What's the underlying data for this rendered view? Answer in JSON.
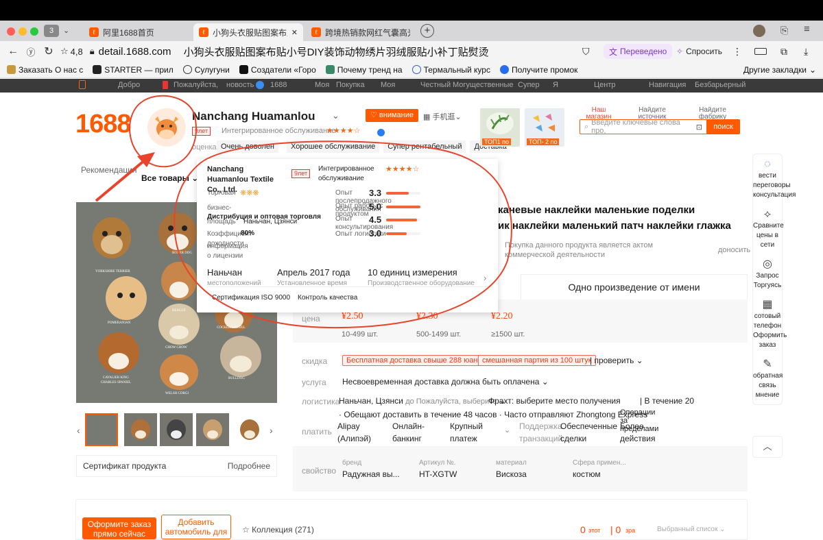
{
  "browser": {
    "tabs": [
      {
        "label": "阿里1688首页"
      },
      {
        "label": "小狗头衣服贴图案布贴小"
      },
      {
        "label": "跨境热销款网红气囊高光唇"
      }
    ],
    "tab_count": "3",
    "rating": "4,8",
    "url": "detail.1688.com",
    "page_title": "小狗头衣服贴图案布贴小号DIY装饰动物绣片羽绒服贴小补丁贴熨烫",
    "translated_label": "Переведено",
    "ask_label": "Спросить",
    "bookmarks": [
      "Заказать О нас с",
      "STARTER — прил",
      "Сулугуни",
      "Создатели «Горо",
      "Почему тренд на",
      "Термальный курс",
      "Получите промок"
    ],
    "other_bookmarks": "Другие закладки"
  },
  "site_nav": [
    "Добро",
    "Пожалуйста,",
    "новость",
    "1688",
    "Моя",
    "Покупка",
    "Моя",
    "Честный",
    "Могущественные",
    "Супер",
    "Я",
    "Центр",
    "Навигация",
    "Безбарьерный"
  ],
  "shop": {
    "logo": "1688",
    "name": "Nanchang Huamanlou",
    "follow": "внимание",
    "mobile": "手机逛",
    "years_badge": "9лет",
    "integrated": "Интегрированное обслуживание",
    "rating_label": "оценка",
    "criteria": [
      "Очень доволен",
      "Хорошее обслуживание",
      "Супер рентабельный",
      "Доставка"
    ],
    "top_badges": [
      "ТОП1 по",
      "ТОП- 2 по"
    ],
    "search_links": [
      "Наш магазин",
      "Найдите источник",
      "Найдите фабрику"
    ],
    "search_placeholder": "Введите ключевые слова про,",
    "search_button": "поиск"
  },
  "menu": {
    "recommend": "Рекомендация",
    "all_goods": "Все товары"
  },
  "popup": {
    "company": "Nanchang Huamanlou Textile Co., Ltd.",
    "years_badge": "9лет",
    "integrated": "Интегрированное обслуживание",
    "trade_medal_label": "Торговая медаль",
    "business_label": "бизнес-",
    "business_value": "Дистрибуция и оптовая торговля",
    "area_label": "площадь",
    "area_value": "Наньчан, Цзянси",
    "coeff_label": "Коэффициент доходности",
    "coeff_value": "80%",
    "license_label": "информация о лицензии",
    "stats": [
      {
        "label": "Опыт послепродажного обслуживания",
        "value": "3.3",
        "fill": 0.66
      },
      {
        "label": "Опыт работы с продуктом",
        "value": "5.0",
        "fill": 1.0
      },
      {
        "label": "Опыт консультирования",
        "value": "4.5",
        "fill": 0.9
      },
      {
        "label": "Опыт логистики",
        "value": "3.0",
        "fill": 0.6
      }
    ],
    "location_value": "Наньчан",
    "location_label": "местоположений",
    "established_value": "Апрель 2017 года",
    "established_label": "Установленное время",
    "units_value": "10 единиц измерения",
    "units_label": "Производственное оборудование",
    "certs": [
      "Сертификация ISO 9000",
      "Контроль качества"
    ]
  },
  "product": {
    "title_line1": "каневые наклейки маленькие поделки",
    "title_line2": "ик наклейки маленький патч наклейки глажка",
    "notice": "Покупка данного продукта является актом коммерческой деятельности",
    "report": "доносить",
    "tab_one": "Одно произведение от имени",
    "price_label": "цена",
    "prices": [
      {
        "price": "¥2.50",
        "range": "10-499 шт."
      },
      {
        "price": "¥2.30",
        "range": "500-1499 шт."
      },
      {
        "price": "¥2.20",
        "range": "≥1500 шт."
      }
    ],
    "discount_label": "скидка",
    "discount_tags": [
      "Бесплатная доставка свыше 288 юаней",
      "смешанная партия из 100 штук"
    ],
    "check": "проверить",
    "service_label": "услуга",
    "service_value": "Несвоевременная доставка должна быть оплачена",
    "logistics_label": "логистика",
    "logistics_from": "Наньчан, Цзянси",
    "logistics_to": "до Пожалуйста, выберите",
    "freight": "Фрахт: выберите место получения",
    "within": "В течение 20",
    "logistics_line2": "· Обещают доставить в течение 48 часов · Часто отправляют Zhongtong Express",
    "ops_more": "Операции за пределами",
    "pay_label": "платить",
    "pay_methods": [
      "Alipay (Алипэй)",
      "Онлайн-банкинг",
      "Крупный платеж"
    ],
    "pay_support": "Поддержка транзакций",
    "pay_support2": "Обеспеченные сделки",
    "pay_support3": "Более действия",
    "attr_label": "свойство",
    "attrs": [
      {
        "k": "бренд",
        "v": "Радужная вы..."
      },
      {
        "k": "Артикул №.",
        "v": "HT-XGTW"
      },
      {
        "k": "материал",
        "v": "Вискоза"
      },
      {
        "k": "Сфера примен...",
        "v": "костюм"
      }
    ],
    "breeds": [
      "YORKSHIRE TERRIER",
      "BOXER DOG",
      "BEAGLE",
      "POMERANIAN",
      "SHIH TZU",
      "COCKER SPANIEL",
      "CHOW CHOW",
      "CAVALIER KING CHARLES SPANIEL",
      "BULLDOG",
      "WELSH CORGI"
    ],
    "certificate": "Сертификат продукта",
    "details": "Подробнее"
  },
  "right_sidebar": [
    {
      "icon": "chat-icon",
      "label": "вести переговоры консультация"
    },
    {
      "icon": "compare-icon",
      "label": "Сравните цены в сети"
    },
    {
      "icon": "target-icon",
      "label": "Запрос Торгуясь"
    },
    {
      "icon": "qr-icon",
      "label": "сотовый телефон Оформить заказ"
    },
    {
      "icon": "edit-icon",
      "label": "обратная связь мнение"
    }
  ],
  "bottom": {
    "order_btn": "Оформите заказ прямо сейчас",
    "cart_btn": "Добавить автомобиль для",
    "collection": "Коллекция (271)",
    "count_this": "0",
    "label_this": "этот",
    "count_zra": "0",
    "label_zra": "зра",
    "selected": "Выбранный список"
  },
  "colors": {
    "accent": "#ff5a00",
    "annotation": "#e8432b"
  }
}
